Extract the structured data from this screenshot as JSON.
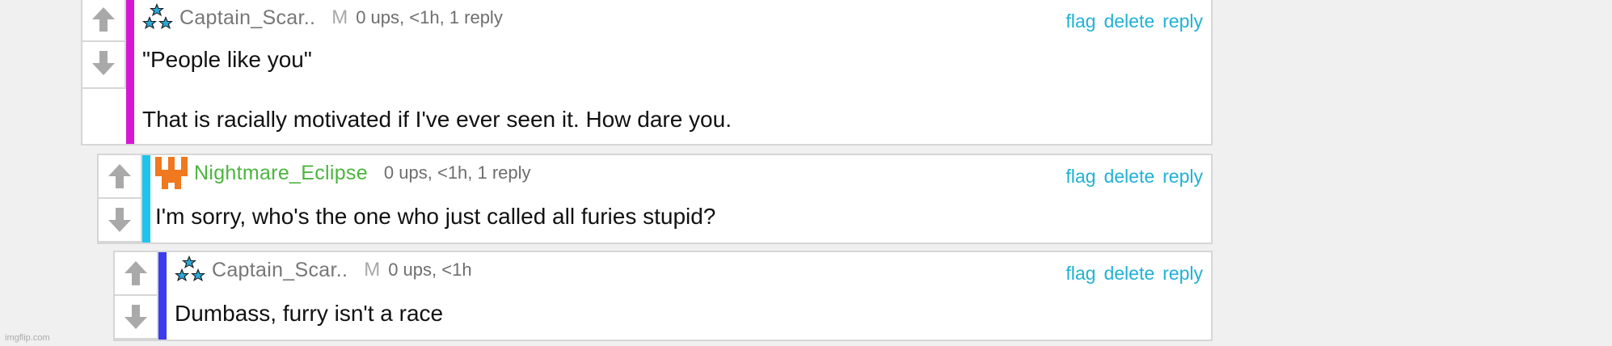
{
  "watermark": "imgflip.com",
  "actions": {
    "flag": "flag",
    "delete": "delete",
    "reply": "reply"
  },
  "colors": {
    "accent_link": "#20b1d6",
    "bar_1": "#d817d6",
    "bar_2": "#1ec4ee",
    "bar_3": "#3b3bef",
    "username_default": "#777777",
    "username_green": "#4cb53f"
  },
  "comments": [
    {
      "username": "Captain_Scar..",
      "mod_badge": "M",
      "meta": "0 ups, <1h, 1 reply",
      "avatar_icon": "stars-avatar-icon",
      "lines": [
        "\"People like you\"",
        "That is racially motivated if I've ever seen it. How dare you."
      ]
    },
    {
      "username": "Nightmare_Eclipse",
      "meta": "0 ups, <1h, 1 reply",
      "avatar_icon": "orange-pixel-avatar-icon",
      "lines": [
        "I'm sorry, who's the one who just called all furies stupid?"
      ]
    },
    {
      "username": "Captain_Scar..",
      "mod_badge": "M",
      "meta": "0 ups, <1h",
      "avatar_icon": "stars-avatar-icon",
      "lines": [
        "Dumbass, furry isn't a race"
      ]
    }
  ]
}
